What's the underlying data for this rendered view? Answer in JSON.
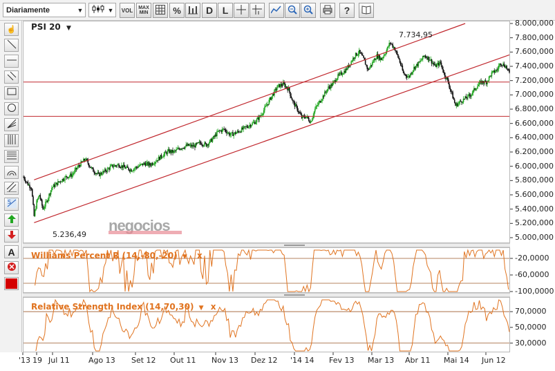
{
  "toolbar": {
    "period_select": "Diariamente",
    "vol_label": "VOL",
    "maxmin_label": "MAX MIN",
    "pct_label": "%",
    "d_label": "D",
    "l_label": "L"
  },
  "main_chart": {
    "symbol": "PSI 20",
    "high_label": "7.734,95",
    "low_label": "5.236,49",
    "watermark": "negocios",
    "y_ticks": [
      "8.000,000",
      "7.800,000",
      "7.600,000",
      "7.400,000",
      "7.200,000",
      "7.000,000",
      "6.800,000",
      "6.600,000",
      "6.400,000",
      "6.200,000",
      "6.000,000",
      "5.800,000",
      "5.600,000",
      "5.400,000",
      "5.200,000",
      "5.000,000"
    ]
  },
  "williams": {
    "title": "Williams Percent R (14,-80,-20)",
    "y_ticks": [
      "-20,0000",
      "-60,0000",
      "-100,0000"
    ]
  },
  "rsi": {
    "title": "Relative Strength Index (14,70,30)",
    "y_ticks": [
      "70,0000",
      "50,0000",
      "30,0000"
    ]
  },
  "x_axis": [
    "'13",
    "19",
    "Jul 11",
    "Ago 13",
    "Set 12",
    "Out 11",
    "Nov 13",
    "Dez 12",
    "'14 14",
    "Fev 13",
    "Mar 13",
    "Abr 11",
    "Mai 14",
    "Jun 12"
  ],
  "colors": {
    "up": "#22a722",
    "down": "#111111",
    "channel": "#c0272d",
    "indicator": "#e0731f"
  },
  "chart_data": {
    "type": "candlestick",
    "title": "PSI 20",
    "ylim": [
      5000,
      8000
    ],
    "anchors": [
      [
        0,
        5850
      ],
      [
        5,
        5750
      ],
      [
        9,
        5700
      ],
      [
        12,
        5300
      ],
      [
        15,
        5500
      ],
      [
        18,
        5600
      ],
      [
        22,
        5400
      ],
      [
        26,
        5500
      ],
      [
        32,
        5700
      ],
      [
        40,
        5780
      ],
      [
        48,
        5850
      ],
      [
        55,
        5880
      ],
      [
        62,
        6000
      ],
      [
        70,
        6100
      ],
      [
        78,
        5950
      ],
      [
        85,
        5880
      ],
      [
        92,
        5930
      ],
      [
        100,
        6000
      ],
      [
        108,
        6020
      ],
      [
        115,
        5980
      ],
      [
        122,
        5950
      ],
      [
        130,
        6000
      ],
      [
        137,
        6040
      ],
      [
        143,
        6020
      ],
      [
        150,
        6080
      ],
      [
        157,
        6150
      ],
      [
        164,
        6210
      ],
      [
        170,
        6200
      ],
      [
        178,
        6260
      ],
      [
        186,
        6290
      ],
      [
        193,
        6280
      ],
      [
        200,
        6330
      ],
      [
        207,
        6300
      ],
      [
        214,
        6380
      ],
      [
        220,
        6480
      ],
      [
        227,
        6520
      ],
      [
        234,
        6440
      ],
      [
        241,
        6470
      ],
      [
        248,
        6520
      ],
      [
        255,
        6570
      ],
      [
        262,
        6620
      ],
      [
        268,
        6700
      ],
      [
        275,
        6850
      ],
      [
        282,
        7000
      ],
      [
        288,
        7120
      ],
      [
        294,
        7150
      ],
      [
        300,
        7080
      ],
      [
        305,
        6900
      ],
      [
        310,
        6800
      ],
      [
        315,
        6680
      ],
      [
        320,
        6700
      ],
      [
        325,
        6620
      ],
      [
        330,
        6800
      ],
      [
        335,
        6900
      ],
      [
        340,
        7000
      ],
      [
        345,
        7100
      ],
      [
        350,
        7150
      ],
      [
        355,
        7250
      ],
      [
        360,
        7300
      ],
      [
        365,
        7350
      ],
      [
        370,
        7450
      ],
      [
        375,
        7550
      ],
      [
        380,
        7600
      ],
      [
        385,
        7500
      ],
      [
        390,
        7350
      ],
      [
        395,
        7450
      ],
      [
        400,
        7550
      ],
      [
        405,
        7500
      ],
      [
        410,
        7600
      ],
      [
        415,
        7735
      ],
      [
        420,
        7650
      ],
      [
        425,
        7500
      ],
      [
        430,
        7300
      ],
      [
        436,
        7250
      ],
      [
        442,
        7380
      ],
      [
        448,
        7450
      ],
      [
        454,
        7550
      ],
      [
        460,
        7500
      ],
      [
        466,
        7400
      ],
      [
        472,
        7450
      ],
      [
        476,
        7300
      ],
      [
        480,
        7200
      ],
      [
        484,
        7050
      ],
      [
        489,
        6850
      ],
      [
        494,
        6900
      ],
      [
        500,
        6950
      ],
      [
        506,
        7000
      ],
      [
        512,
        7100
      ],
      [
        518,
        7180
      ],
      [
        524,
        7180
      ],
      [
        530,
        7300
      ],
      [
        536,
        7350
      ],
      [
        540,
        7450
      ],
      [
        546,
        7400
      ],
      [
        550,
        7300
      ]
    ],
    "williams_range": [
      -100,
      0
    ],
    "williams_levels": [
      -20,
      -80
    ],
    "rsi_range": [
      20,
      85
    ],
    "rsi_levels": [
      70,
      30
    ]
  }
}
